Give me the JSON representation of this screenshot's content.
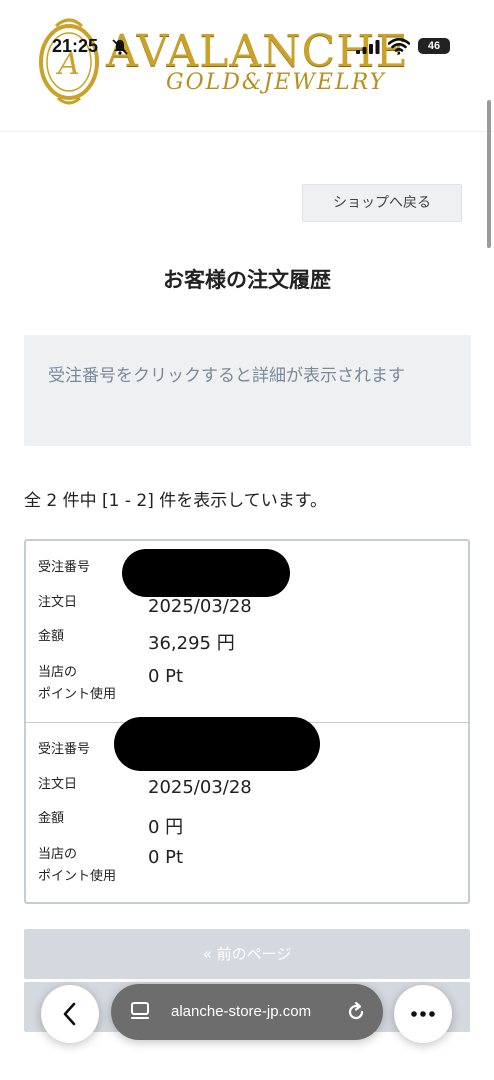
{
  "status_bar": {
    "time": "21:25",
    "battery": "46"
  },
  "brand": {
    "name": "AVALANCHE",
    "sub": "GOLD&JEWELRY",
    "emblem_letter": "A"
  },
  "toolbar": {
    "back_to_shop": "ショップへ戻る"
  },
  "page": {
    "title": "お客様の注文履歴",
    "notice": "受注番号をクリックすると詳細が表示されます",
    "summary": "全 2 件中 [1 - 2] 件を表示しています。"
  },
  "labels": {
    "order_number": "受注番号",
    "order_date": "注文日",
    "amount": "金額",
    "points_line1": "当店の",
    "points_line2": "ポイント使用"
  },
  "orders": [
    {
      "date": "2025/03/28",
      "amount": "36,295 円",
      "points": "0 Pt"
    },
    {
      "date": "2025/03/28",
      "amount": "0 円",
      "points": "0 Pt"
    }
  ],
  "pagination": {
    "prev": "« 前のページ"
  },
  "browser": {
    "url": "alanche-store-jp.com"
  }
}
